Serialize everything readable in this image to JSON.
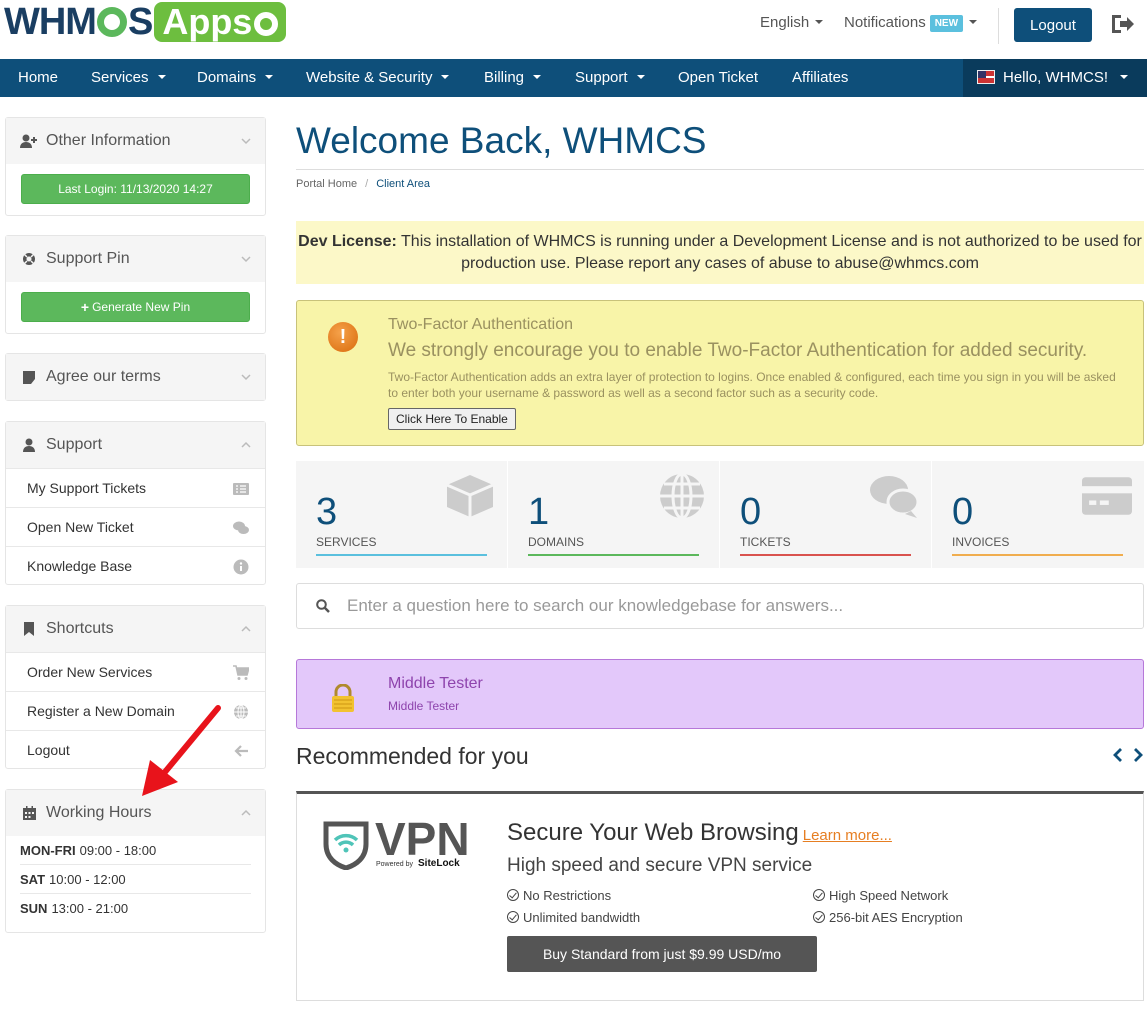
{
  "brand": {
    "logo_part1": "WHM",
    "logo_part2": "S",
    "logo_apps": "Apps"
  },
  "header": {
    "language": "English",
    "notifications": "Notifications",
    "notifications_badge": "NEW",
    "logout": "Logout"
  },
  "nav": {
    "items": [
      "Home",
      "Services",
      "Domains",
      "Website & Security",
      "Billing",
      "Support",
      "Open Ticket",
      "Affiliates"
    ],
    "user": "Hello, WHMCS!"
  },
  "sidebar": {
    "other_info": {
      "title": "Other Information",
      "button": "Last Login: 11/13/2020 14:27"
    },
    "support_pin": {
      "title": "Support Pin",
      "button": "Generate New Pin"
    },
    "terms": {
      "title": "Agree our terms"
    },
    "support": {
      "title": "Support",
      "items": [
        "My Support Tickets",
        "Open New Ticket",
        "Knowledge Base"
      ]
    },
    "shortcuts": {
      "title": "Shortcuts",
      "items": [
        "Order New Services",
        "Register a New Domain",
        "Logout"
      ]
    },
    "hours": {
      "title": "Working Hours",
      "rows": [
        {
          "day": "MON-FRI",
          "time": "09:00 - 18:00"
        },
        {
          "day": "SAT",
          "time": "10:00 - 12:00"
        },
        {
          "day": "SUN",
          "time": "13:00 - 21:00"
        }
      ]
    }
  },
  "main": {
    "title": "Welcome Back, WHMCS",
    "breadcrumb": [
      "Portal Home",
      "Client Area"
    ],
    "dev_license_label": "Dev License:",
    "dev_license_text": "This installation of WHMCS is running under a Development License and is not authorized to be used for production use. Please report any cases of abuse to abuse@whmcs.com",
    "tfa": {
      "title": "Two-Factor Authentication",
      "subtitle": "We strongly encourage you to enable Two-Factor Authentication for added security.",
      "body": "Two-Factor Authentication adds an extra layer of protection to logins. Once enabled & configured, each time you sign in you will be asked to enter both your username & password as well as a second factor such as a security code.",
      "button": "Click Here To Enable"
    },
    "stats": [
      {
        "value": "3",
        "label": "SERVICES",
        "color": "#5bc0de"
      },
      {
        "value": "1",
        "label": "DOMAINS",
        "color": "#5cb85c"
      },
      {
        "value": "0",
        "label": "TICKETS",
        "color": "#d9534f"
      },
      {
        "value": "0",
        "label": "INVOICES",
        "color": "#f0ad4e"
      }
    ],
    "search_placeholder": "Enter a question here to search our knowledgebase for answers...",
    "middle": {
      "title": "Middle Tester",
      "subtitle": "Middle Tester"
    },
    "recommended_title": "Recommended for you",
    "vpn": {
      "logo_text": "VPN",
      "powered_by": "Powered by",
      "powered_brand": "SiteLock",
      "heading": "Secure Your Web Browsing",
      "learn_more": "Learn more...",
      "subheading": "High speed and secure VPN service",
      "features": [
        "No Restrictions",
        "High Speed Network",
        "Unlimited bandwidth",
        "256-bit AES Encryption"
      ],
      "buy_button": "Buy Standard from just $9.99 USD/mo"
    }
  },
  "colors": {
    "primary": "#0e4f7a",
    "success": "#5cb85c",
    "warning_bg": "#f8f4a8",
    "purple": "#8e44ad",
    "annotation": "#e8131b"
  }
}
